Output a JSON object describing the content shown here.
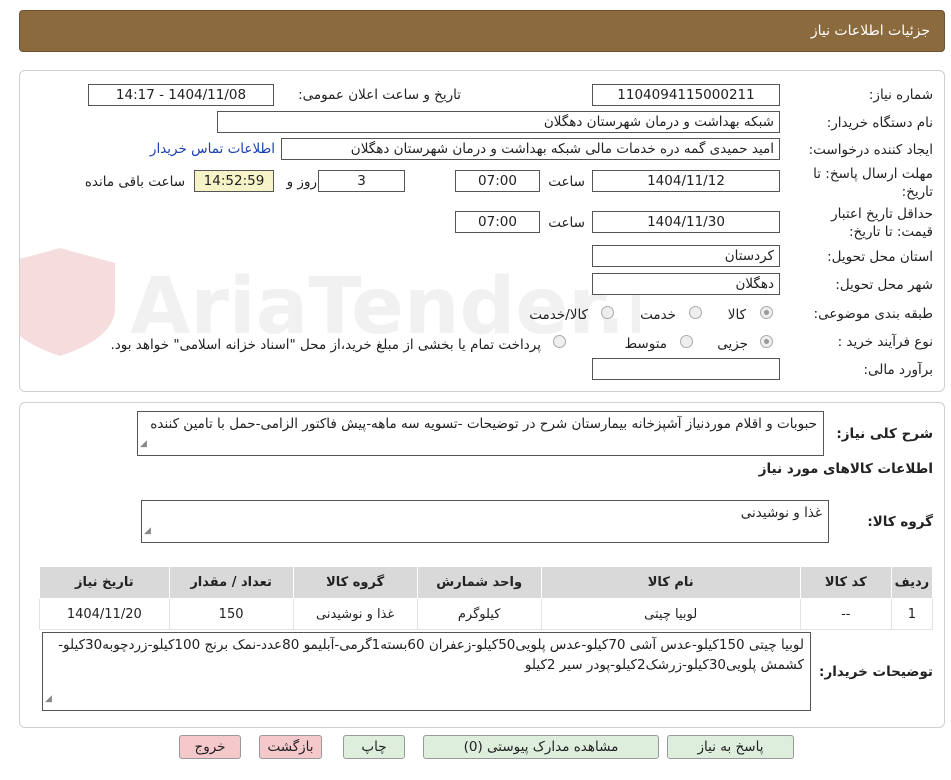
{
  "header": {
    "title": "جزئیات اطلاعات نیاز"
  },
  "watermark": {
    "text": "AriaTender.neT"
  },
  "form": {
    "need_number_label": "شماره نیاز:",
    "need_number": "1104094115000211",
    "announce_label": "تاریخ و ساعت اعلان عمومی:",
    "announce_value": "1404/11/08 - 14:17",
    "buyer_org_label": "نام دستگاه خریدار:",
    "buyer_org": "شبکه بهداشت و درمان شهرستان دهگلان",
    "creator_label": "ایجاد کننده درخواست:",
    "creator": "امید حمیدی گمه دره خدمات مالی شبکه بهداشت و درمان شهرستان دهگلان",
    "contact_link": "اطلاعات تماس خریدار",
    "deadline_label_1": "مهلت ارسال پاسخ: تا",
    "deadline_label_2": "تاریخ:",
    "deadline_date": "1404/11/12",
    "time_label": "ساعت",
    "deadline_time": "07:00",
    "days_value": "3",
    "days_label": "روز و",
    "remaining_time": "14:52:59",
    "remaining_label": "ساعت باقی مانده",
    "validity_label_1": "حداقل تاریخ اعتبار",
    "validity_label_2": "قیمت: تا تاریخ:",
    "validity_date": "1404/11/30",
    "validity_time": "07:00",
    "province_label": "استان محل تحویل:",
    "province": "کردستان",
    "city_label": "شهر محل تحویل:",
    "city": "دهگلان",
    "category_label": "طبقه بندی موضوعی:",
    "category_options": [
      "کالا",
      "خدمت",
      "کالا/خدمت"
    ],
    "process_label": "نوع فرآیند خرید :",
    "process_options": [
      "جزیی",
      "متوسط"
    ],
    "payment_note": "پرداخت تمام یا بخشی از مبلغ خرید،از محل \"اسناد خزانه اسلامی\" خواهد بود.",
    "estimate_label": "برآورد مالی:",
    "estimate_value": ""
  },
  "summary": {
    "label": "شرح کلی نیاز:",
    "text": "حبوبات و اقلام موردنیاز آشپزخانه بیمارستان شرح در توضیحات -تسویه سه ماهه-پیش فاکتور الزامی-حمل با تامین کننده"
  },
  "goods": {
    "section_title": "اطلاعات کالاهای مورد نیاز",
    "group_label": "گروه کالا:",
    "group_value": "غذا و نوشیدنی",
    "columns": [
      "ردیف",
      "کد کالا",
      "نام کالا",
      "واحد شمارش",
      "گروه کالا",
      "تعداد / مقدار",
      "تاریخ نیاز"
    ],
    "rows": [
      [
        "1",
        "--",
        "لوبیا چیتی",
        "کیلوگرم",
        "غذا و نوشیدنی",
        "150",
        "1404/11/20"
      ]
    ]
  },
  "buyer_notes": {
    "label": "توضیحات خریدار:",
    "text": "لوبیا چیتی 150کیلو-عدس آشی 70کیلو-عدس پلویی50کیلو-زعفران 60بسته1گرمی-آبلیمو 80عدد-نمک برنج 100کیلو-زردچوبه30کیلو-کشمش پلویی30کیلو-زرشک2کیلو-پودر سیر 2کیلو"
  },
  "buttons": {
    "reply": "پاسخ به نیاز",
    "attachments": "مشاهده مدارک پیوستی (0)",
    "print": "چاپ",
    "back": "بازگشت",
    "exit": "خروج"
  },
  "colors": {
    "header_bg": "#8b6a3e",
    "button_green": "#ddeedd",
    "button_pink": "#f5c9cc",
    "link": "#1a3fb0"
  }
}
